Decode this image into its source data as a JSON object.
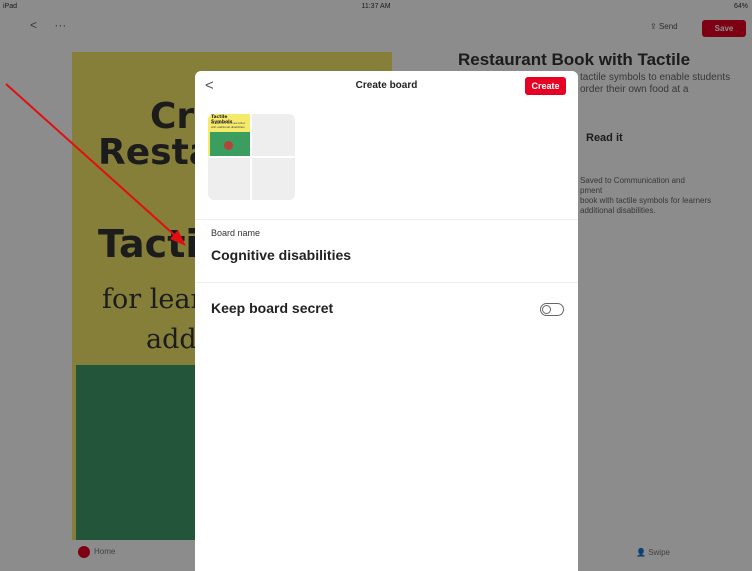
{
  "status_bar": {
    "left": "iPad",
    "time": "11:37 AM",
    "battery": "64%"
  },
  "background": {
    "back_symbol": "<",
    "more_symbol": "···",
    "send_label": "Send",
    "save_label": "Save",
    "pin_text": {
      "line1": "Cr",
      "line2": "Restau",
      "line3": "Tactil",
      "line4": "for learner",
      "line5": "additi"
    },
    "right_title": "Restaurant Book with Tactile Symbols",
    "right_desc_line1": "tactile symbols to enable students",
    "right_desc_line2": "order their own food at a",
    "read_it_label": "Read it",
    "saved_line1": "Saved to Communication and",
    "saved_line2": "pment",
    "saved_line3": "book with tactile symbols for learners",
    "saved_line4": "additional disabilities.",
    "home_label": "Home",
    "user_label": "Swipe"
  },
  "modal": {
    "title": "Create board",
    "back_symbol": "<",
    "create_label": "Create",
    "thumbnail": {
      "title": "Tactile Symbols",
      "subtitle": "for learners who are blind with additional disabilities"
    },
    "board_name_label": "Board name",
    "board_name_value": "Cognitive disabilities",
    "secret_label": "Keep board secret",
    "secret_enabled": false
  },
  "colors": {
    "accent": "#e60023",
    "annotation_arrow": "#e01010"
  }
}
